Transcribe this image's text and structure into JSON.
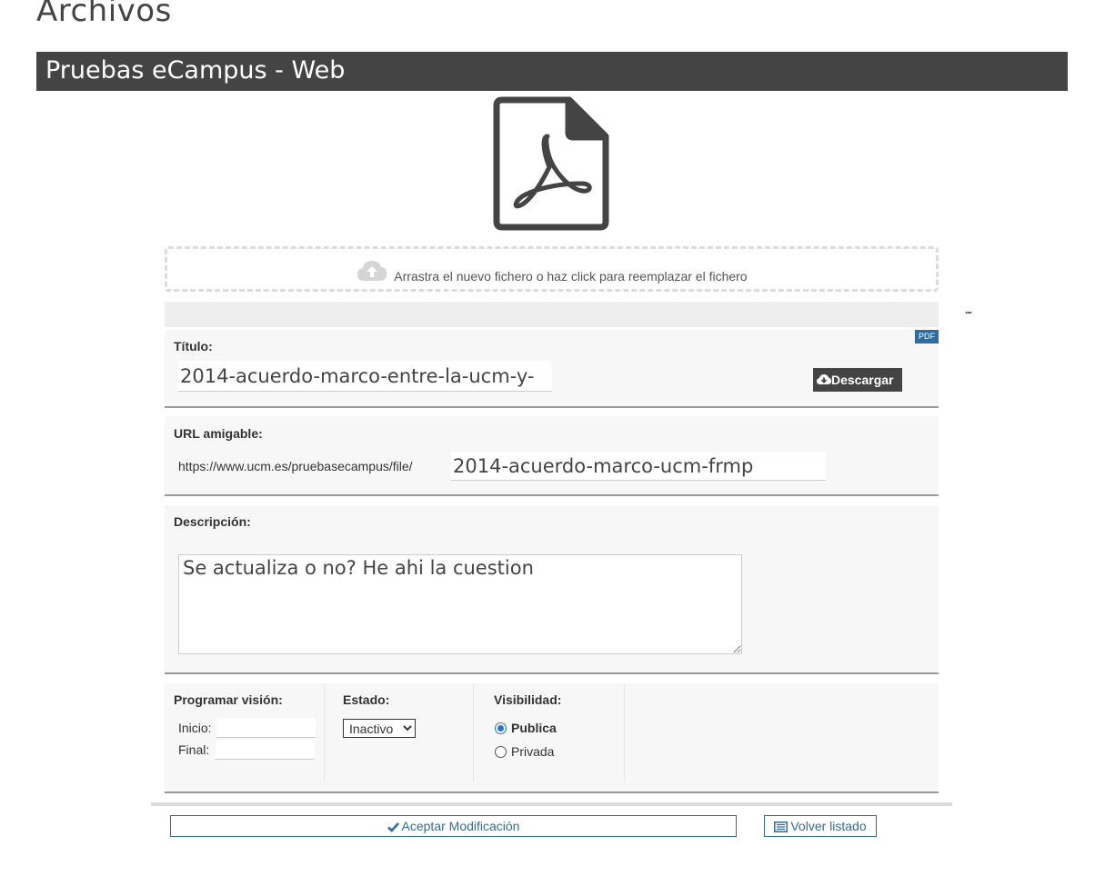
{
  "page": {
    "title": "Archivos"
  },
  "site": {
    "name": "Pruebas eCampus - Web"
  },
  "upload": {
    "hint": "Arrastra el nuevo fichero o haz click para reemplazar el fichero"
  },
  "toolbar": {
    "ellipsis": "..."
  },
  "file": {
    "type_badge": "PDF",
    "title_label": "Título:",
    "title_value": "2014-acuerdo-marco-entre-la-ucm-y-",
    "download_label": "Descargar",
    "url_label": "URL amigable:",
    "url_prefix": "https://www.ucm.es/pruebasecampus/file/",
    "url_value": "2014-acuerdo-marco-ucm-frmp",
    "description_label": "Descripción:",
    "description_value": "Se actualiza o no? He ahi la cuestion"
  },
  "schedule": {
    "label": "Programar visión:",
    "start_label": "Inicio:",
    "end_label": "Final:",
    "start_value": "",
    "end_value": ""
  },
  "status": {
    "label": "Estado:",
    "selected": "Inactivo"
  },
  "visibility": {
    "label": "Visibilidad:",
    "options": [
      {
        "label": "Publica",
        "selected": true
      },
      {
        "label": "Privada",
        "selected": false
      }
    ]
  },
  "actions": {
    "accept_label": "Aceptar Modificación",
    "back_label": "Volver listado"
  },
  "colors": {
    "header_bg": "#444444",
    "accent": "#2e6da4",
    "radio_on": "#2276d2"
  },
  "icons": [
    "pdf-file-icon",
    "cloud-upload-icon",
    "cloud-download-icon",
    "check-icon",
    "list-icon"
  ]
}
